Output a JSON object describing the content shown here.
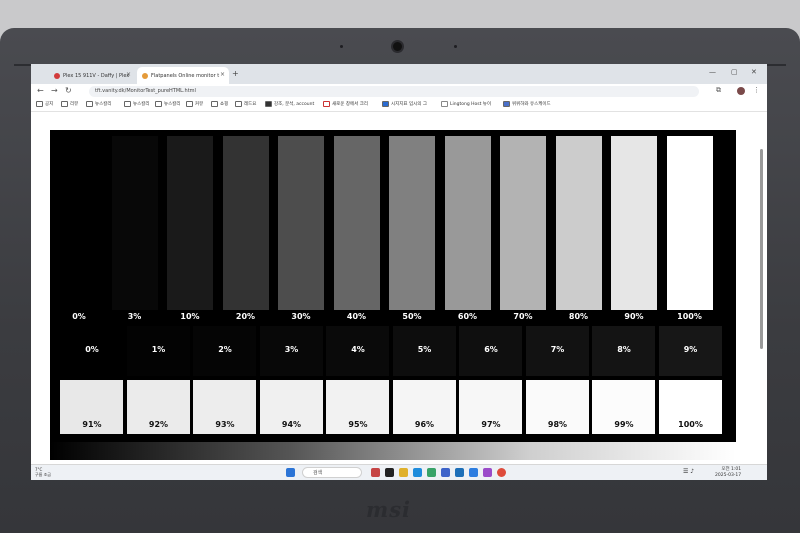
{
  "browser": {
    "tabs": [
      {
        "label": "Plex 15 911V - Daffy | Plex"
      },
      {
        "label": "Flatpanels Online monitor t"
      }
    ],
    "url": "tft.vanity.dk/MonitorTest_pureHTML.html",
    "bookmarks": [
      "공지",
      "리뷰",
      "뉴스칼리",
      "뉴스칼리",
      "뉴스칼리",
      "커뮤",
      "쇼핑",
      "레드요",
      "강조, 분석, account",
      "새로운 창에서 크리",
      "시지지표 입시의 그",
      "Lingtong Host 뉴이",
      "위위하와 유스케이드"
    ]
  },
  "gray_bars": {
    "labels": [
      "0%",
      "3%",
      "10%",
      "20%",
      "30%",
      "40%",
      "50%",
      "60%",
      "70%",
      "80%",
      "90%",
      "100%"
    ],
    "levels": [
      0,
      3,
      10,
      20,
      30,
      40,
      50,
      60,
      70,
      80,
      90,
      100
    ]
  },
  "black_boxes": {
    "labels": [
      "0%",
      "1%",
      "2%",
      "3%",
      "4%",
      "5%",
      "6%",
      "7%",
      "8%",
      "9%"
    ],
    "levels": [
      0,
      1,
      2,
      3,
      4,
      5,
      6,
      7,
      8,
      9
    ]
  },
  "white_boxes": {
    "labels": [
      "91%",
      "92%",
      "93%",
      "94%",
      "95%",
      "96%",
      "97%",
      "98%",
      "99%",
      "100%"
    ],
    "levels": [
      91,
      92,
      93,
      94,
      95,
      96,
      97,
      98,
      99,
      100
    ]
  },
  "taskbar": {
    "weather": [
      "7°C",
      "구름 조금"
    ],
    "search_placeholder": "검색",
    "time": "오전 1:01",
    "date": "2025-03-17"
  },
  "brand": "msi"
}
